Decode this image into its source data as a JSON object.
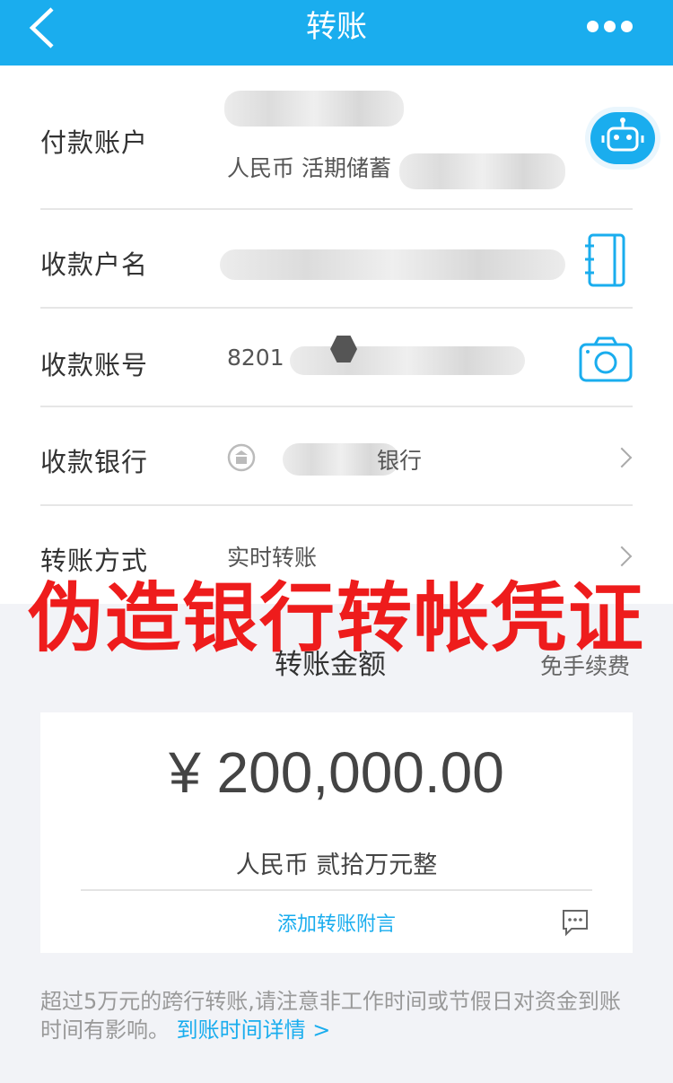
{
  "header": {
    "title": "转账"
  },
  "form": {
    "payer": {
      "label": "付款账户",
      "account_type": "人民币 活期储蓄"
    },
    "payee_name": {
      "label": "收款户名"
    },
    "payee_account": {
      "label": "收款账号",
      "account_prefix": "8201"
    },
    "payee_bank": {
      "label": "收款银行",
      "bank_suffix": "银行"
    },
    "transfer_method": {
      "label": "转账方式",
      "value": "实时转账"
    }
  },
  "watermark": "伪造银行转帐凭证",
  "amount": {
    "title": "转账金额",
    "fee_note": "免手续费",
    "value": "¥ 200,000.00",
    "in_words": "人民币 贰拾万元整",
    "memo_link": "添加转账附言"
  },
  "notice": {
    "text": "超过5万元的跨行转账,请注意非工作时间或节假日对资金到账时间有影响。",
    "link": "到账时间详情 >"
  },
  "colors": {
    "brand_blue": "#1aadee",
    "watermark_red": "#ee1c1c"
  },
  "icons": [
    "back-arrow-icon",
    "more-icon",
    "robot-icon",
    "address-book-icon",
    "camera-icon",
    "bank-icon",
    "chevron-right-icon",
    "message-icon"
  ]
}
